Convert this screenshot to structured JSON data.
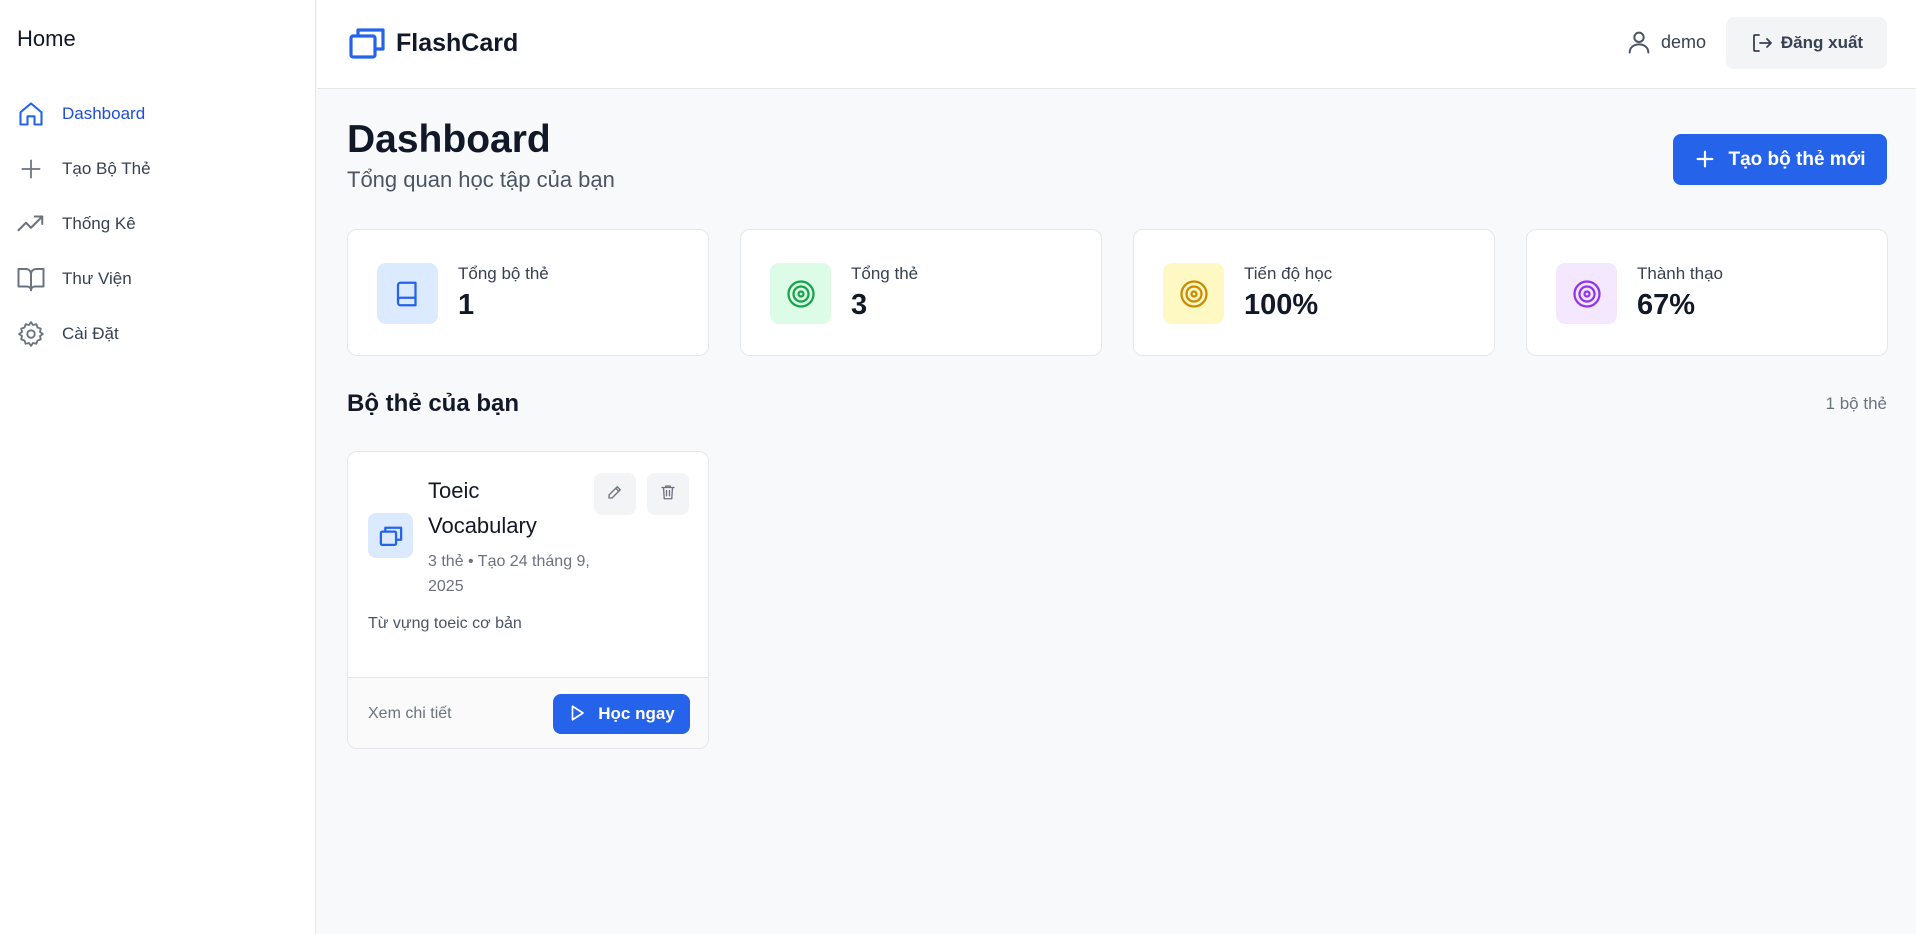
{
  "sidebar": {
    "title": "Home",
    "items": [
      {
        "label": "Dashboard",
        "icon": "home-icon",
        "active": true
      },
      {
        "label": "Tạo Bộ Thẻ",
        "icon": "plus-icon"
      },
      {
        "label": "Thống Kê",
        "icon": "trending-up-icon"
      },
      {
        "label": "Thư Viện",
        "icon": "book-open-icon"
      },
      {
        "label": "Cài Đặt",
        "icon": "gear-icon"
      }
    ]
  },
  "header": {
    "brand": "FlashCard",
    "username": "demo",
    "logout_label": "Đăng xuất"
  },
  "main": {
    "title": "Dashboard",
    "subtitle": "Tổng quan học tập của bạn",
    "new_deck_label": "Tạo bộ thẻ mới",
    "stats": [
      {
        "label": "Tổng bộ thẻ",
        "value": "1",
        "icon": "book-icon",
        "color": "#2563eb",
        "bg": "#dbeafe"
      },
      {
        "label": "Tổng thẻ",
        "value": "3",
        "icon": "target-icon",
        "color": "#16a34a",
        "bg": "#dcfce7"
      },
      {
        "label": "Tiến độ học",
        "value": "100%",
        "icon": "target-icon",
        "color": "#ca8a04",
        "bg": "#fef9c3"
      },
      {
        "label": "Thành thạo",
        "value": "67%",
        "icon": "target-icon",
        "color": "#9333ea",
        "bg": "#f3e8ff"
      }
    ],
    "section_title": "Bộ thẻ của bạn",
    "section_count": "1 bộ thẻ",
    "decks": [
      {
        "name": "Toeic Vocabulary",
        "meta": "3 thẻ • Tạo 24 tháng 9, 2025",
        "description": "Từ vựng toeic cơ bản",
        "view_label": "Xem chi tiết",
        "study_label": "Học ngay"
      }
    ]
  },
  "colors": {
    "accent": "#2563eb",
    "accent_dark": "#1d4ed8"
  }
}
